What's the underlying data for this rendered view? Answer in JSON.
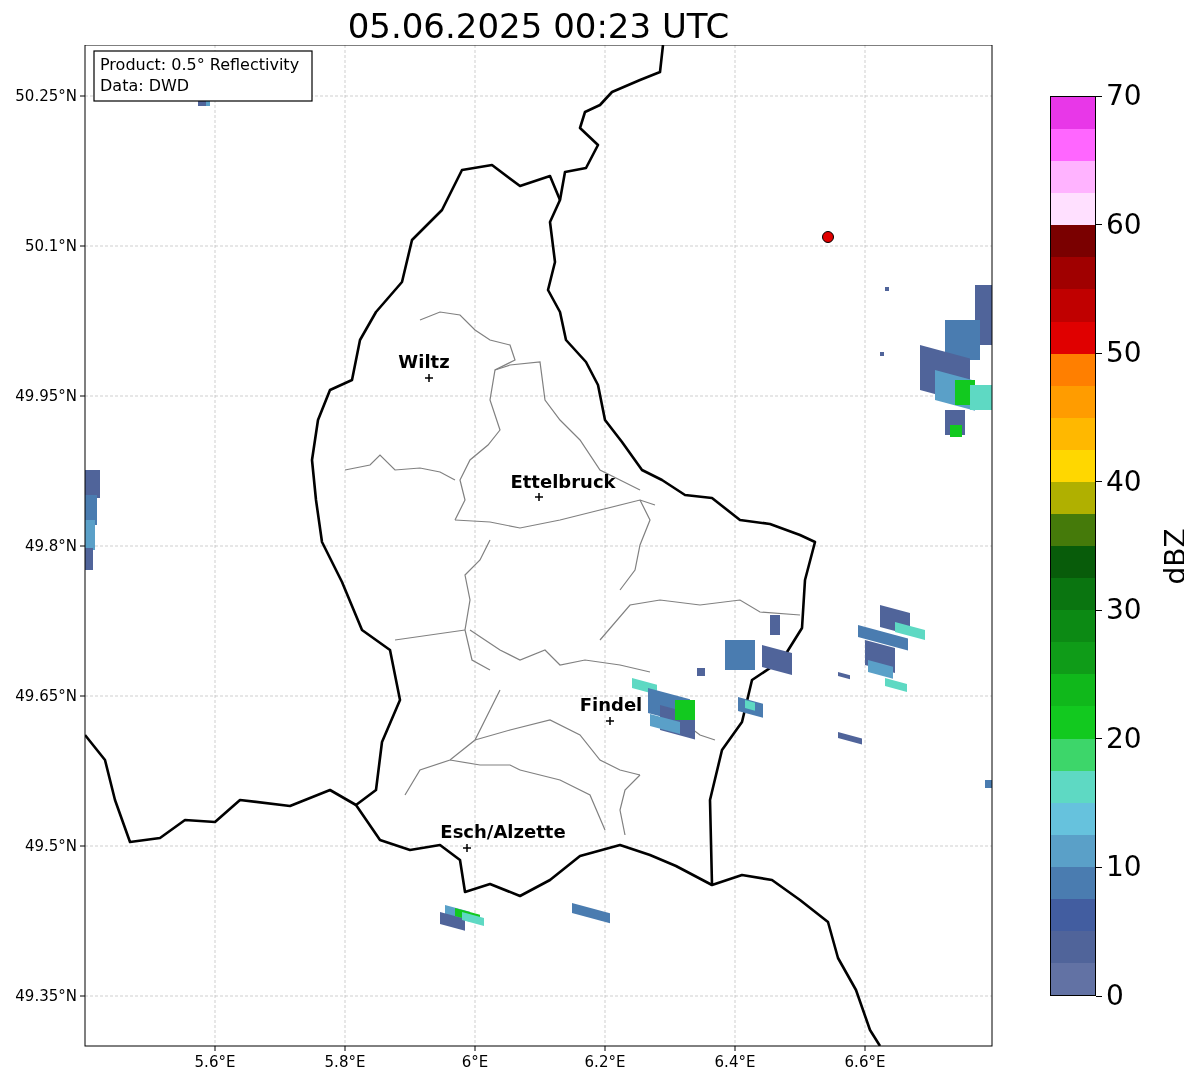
{
  "title": "05.06.2025 00:23 UTC",
  "info_box": {
    "lines": [
      "Product: 0.5° Reflectivity",
      "Data: DWD"
    ]
  },
  "map": {
    "x_ticks": [
      "5.6°E",
      "5.8°E",
      "6°E",
      "6.2°E",
      "6.4°E",
      "6.6°E"
    ],
    "y_ticks": [
      "50.25°N",
      "50.1°N",
      "49.95°N",
      "49.8°N",
      "49.65°N",
      "49.5°N",
      "49.35°N"
    ],
    "cities": [
      {
        "name": "Wiltz"
      },
      {
        "name": "Ettelbruck"
      },
      {
        "name": "Findel"
      },
      {
        "name": "Esch/Alzette"
      }
    ]
  },
  "colorbar": {
    "label": "dBZ",
    "ticks": [
      "70",
      "60",
      "50",
      "40",
      "30",
      "20",
      "10",
      "0"
    ],
    "levels": [
      {
        "color": "#e837e8"
      },
      {
        "color": "#ff66ff"
      },
      {
        "color": "#ffb3ff"
      },
      {
        "color": "#ffe0ff"
      },
      {
        "color": "#7a0000"
      },
      {
        "color": "#a00000"
      },
      {
        "color": "#c00000"
      },
      {
        "color": "#e00000"
      },
      {
        "color": "#ff7f00"
      },
      {
        "color": "#ff9c00"
      },
      {
        "color": "#ffb800"
      },
      {
        "color": "#ffd700"
      },
      {
        "color": "#b0b000"
      },
      {
        "color": "#457a0a"
      },
      {
        "color": "#085c0a"
      },
      {
        "color": "#0a7510"
      },
      {
        "color": "#0c8a14"
      },
      {
        "color": "#0f9c18"
      },
      {
        "color": "#10b81b"
      },
      {
        "color": "#12c91f"
      },
      {
        "color": "#3dd66a"
      },
      {
        "color": "#5ed9c3"
      },
      {
        "color": "#66c2dd"
      },
      {
        "color": "#5aa0c8"
      },
      {
        "color": "#4a7cb0"
      },
      {
        "color": "#425da0"
      },
      {
        "color": "#50649a"
      },
      {
        "color": "#6272a4"
      }
    ]
  }
}
